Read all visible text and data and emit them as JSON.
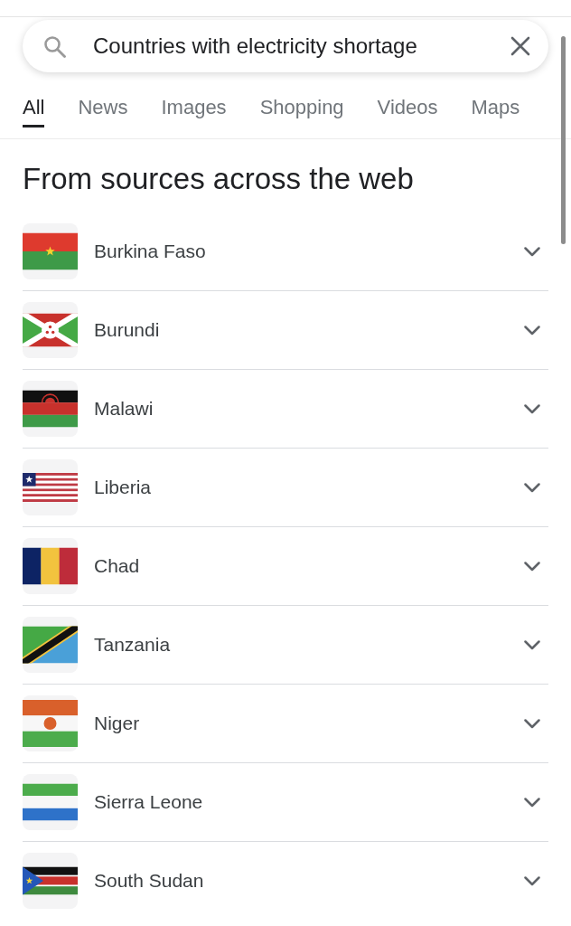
{
  "search": {
    "query": "Countries with electricity shortage"
  },
  "tabs": [
    {
      "label": "All",
      "selected": true
    },
    {
      "label": "News",
      "selected": false
    },
    {
      "label": "Images",
      "selected": false
    },
    {
      "label": "Shopping",
      "selected": false
    },
    {
      "label": "Videos",
      "selected": false
    },
    {
      "label": "Maps",
      "selected": false
    }
  ],
  "heading": "From sources across the web",
  "results": [
    {
      "name": "Burkina Faso",
      "kind": "burkina",
      "expanded": false
    },
    {
      "name": "Burundi",
      "kind": "burundi",
      "expanded": false
    },
    {
      "name": "Malawi",
      "kind": "malawi",
      "expanded": false
    },
    {
      "name": "Liberia",
      "kind": "liberia",
      "expanded": false
    },
    {
      "name": "Chad",
      "kind": "chad",
      "expanded": false
    },
    {
      "name": "Tanzania",
      "kind": "tanzania",
      "expanded": false
    },
    {
      "name": "Niger",
      "kind": "niger",
      "expanded": false
    },
    {
      "name": "Sierra Leone",
      "kind": "sierraleone",
      "expanded": false
    },
    {
      "name": "South Sudan",
      "kind": "southsudan",
      "expanded": false
    }
  ]
}
